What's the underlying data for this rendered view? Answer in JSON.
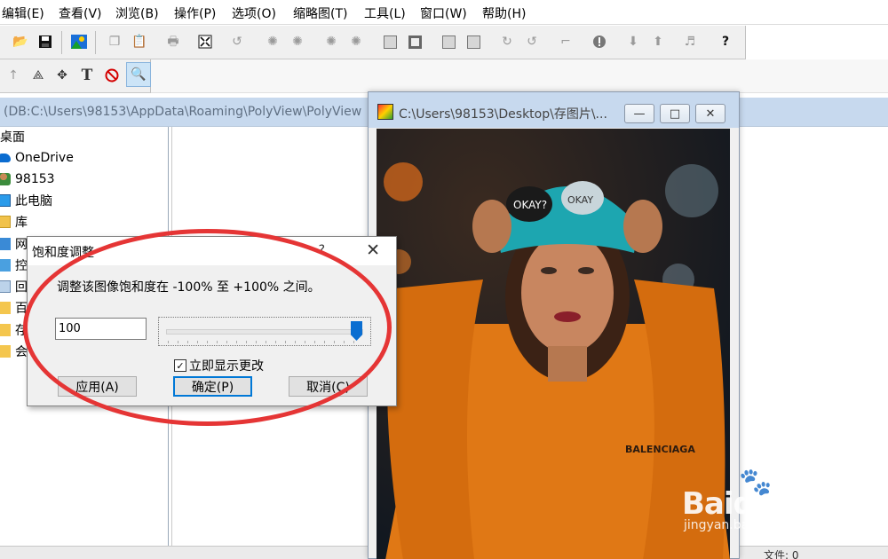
{
  "menu": [
    "编辑(E)",
    "查看(V)",
    "浏览(B)",
    "操作(P)",
    "选项(O)",
    "缩略图(T)",
    "工具(L)",
    "窗口(W)",
    "帮助(H)"
  ],
  "toolbar2": {
    "text_tool_label": "T"
  },
  "main_window": {
    "path": "(DB:C:\\Users\\98153\\AppData\\Roaming\\PolyView\\PolyView"
  },
  "tree": {
    "root": "桌面",
    "items": [
      "OneDrive",
      "98153",
      "此电脑",
      "库",
      "网",
      "控",
      "回",
      "百",
      "存",
      "会"
    ]
  },
  "image_window": {
    "title": "C:\\Users\\98153\\Desktop\\存图片\\...",
    "min_glyph": "—",
    "max_glyph": "□",
    "close_glyph": "✕"
  },
  "photo": {
    "hat_text_1": "OKAY?",
    "hat_text_2": "OKAY",
    "shirt_text": "BALENCIAGA"
  },
  "dialog": {
    "title": "饱和度调整",
    "help_glyph": "?",
    "close_glyph": "✕",
    "message": "调整该图像饱和度在 -100% 至 +100% 之间。",
    "value": "100",
    "slider_value_percent": 100,
    "checkbox_label": "立即显示更改",
    "checkbox_checked": true,
    "checkbox_mark": "✓",
    "apply_label": "应用(A)",
    "ok_label": "确定(P)",
    "cancel_label": "取消(C)"
  },
  "status": {
    "text": "文件: 0"
  },
  "watermark": {
    "brand": "Baidu经验",
    "url": "jingyan.baidu.com",
    "paw": "🐾"
  },
  "colors": {
    "title_bar": "#c7d9ee",
    "annotation_red": "#e53535",
    "accent_blue": "#0078d7"
  }
}
